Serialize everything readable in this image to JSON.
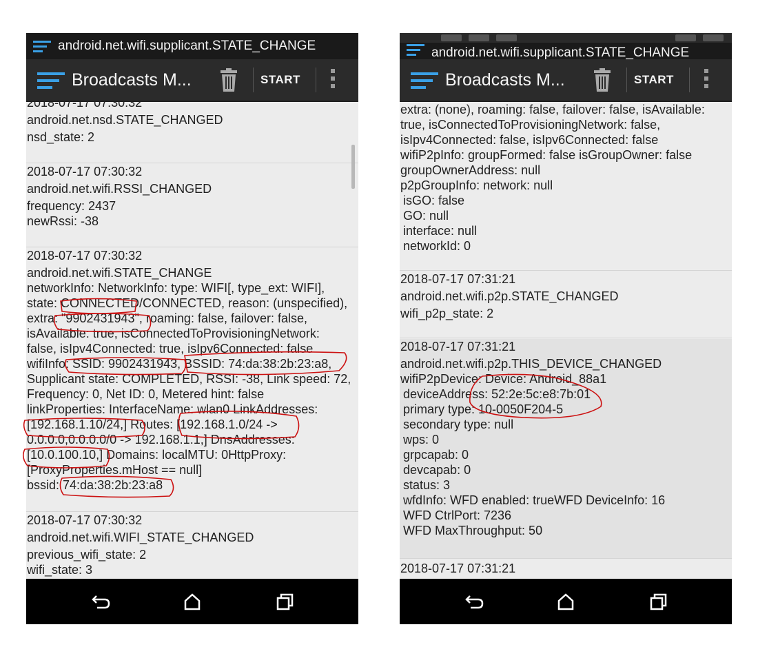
{
  "left": {
    "notification": "android.net.wifi.supplicant.STATE_CHANGE",
    "app_title": "Broadcasts M...",
    "start_label": "START",
    "entries": [
      {
        "lines": [
          "2018-07-17 07:30:32",
          "android.net.nsd.STATE_CHANGED",
          "nsd_state: 2"
        ]
      },
      {
        "lines": [
          "2018-07-17 07:30:32",
          "android.net.wifi.RSSI_CHANGED",
          "frequency: 2437",
          "newRssi: -38"
        ]
      },
      {
        "lines": [
          "2018-07-17 07:30:32",
          "android.net.wifi.STATE_CHANGE",
          "networkInfo: NetworkInfo: type: WIFI[, type_ext: WIFI],",
          "state: CONNECTED/CONNECTED, reason: (unspecified),",
          "extra: \"9902431943\", roaming: false, failover: false,",
          "isAvailable: true, isConnectedToProvisioningNetwork:",
          "false, isIpv4Connected: true, isIpv6Connected: false",
          "wifiInfo: SSID: 9902431943, BSSID: 74:da:38:2b:23:a8,",
          "Supplicant state: COMPLETED, RSSI: -38, Link speed: 72,",
          "Frequency: 0, Net ID: 0, Metered hint: false",
          "linkProperties: InterfaceName: wlan0 LinkAddresses:",
          "[192.168.1.10/24,] Routes: [192.168.1.0/24 ->",
          "0.0.0.0,0.0.0.0/0 -> 192.168.1.1,] DnsAddresses:",
          "[10.0.100.10,] Domains: localMTU: 0HttpProxy:",
          "[ProxyProperties.mHost == null]",
          "bssid: 74:da:38:2b:23:a8"
        ]
      },
      {
        "lines": [
          "2018-07-17 07:30:32",
          "android.net.wifi.WIFI_STATE_CHANGED",
          "previous_wifi_state: 2",
          "wifi_state: 3"
        ]
      }
    ]
  },
  "right": {
    "notification": "android.net.wifi.supplicant.STATE_CHANGE",
    "app_title": "Broadcasts M...",
    "start_label": "START",
    "entries": [
      {
        "lines": [
          "extra: (none), roaming: false, failover: false, isAvailable:",
          "true, isConnectedToProvisioningNetwork: false,",
          "isIpv4Connected: false, isIpv6Connected: false",
          "wifiP2pInfo: groupFormed: false isGroupOwner: false",
          "groupOwnerAddress: null",
          "p2pGroupInfo: network: null",
          " isGO: false",
          " GO: null",
          " interface: null",
          " networkId: 0"
        ]
      },
      {
        "lines": [
          "2018-07-17 07:31:21",
          "android.net.wifi.p2p.STATE_CHANGED",
          "wifi_p2p_state: 2"
        ]
      },
      {
        "lines": [
          "2018-07-17 07:31:21",
          "android.net.wifi.p2p.THIS_DEVICE_CHANGED",
          "wifiP2pDevice: Device: Android_88a1",
          " deviceAddress: 52:2e:5c:e8:7b:01",
          " primary type: 10-0050F204-5",
          " secondary type: null",
          " wps: 0",
          " grpcapab: 0",
          " devcapab: 0",
          " status: 3",
          " wfdInfo: WFD enabled: trueWFD DeviceInfo: 16",
          " WFD CtrlPort: 7236",
          " WFD MaxThroughput: 50"
        ]
      },
      {
        "lines": [
          "2018-07-17 07:31:21"
        ]
      }
    ]
  },
  "colors": {
    "annotation": "#cc1111",
    "actionbar": "#2b2b2b",
    "accent": "#3aa0e6"
  }
}
